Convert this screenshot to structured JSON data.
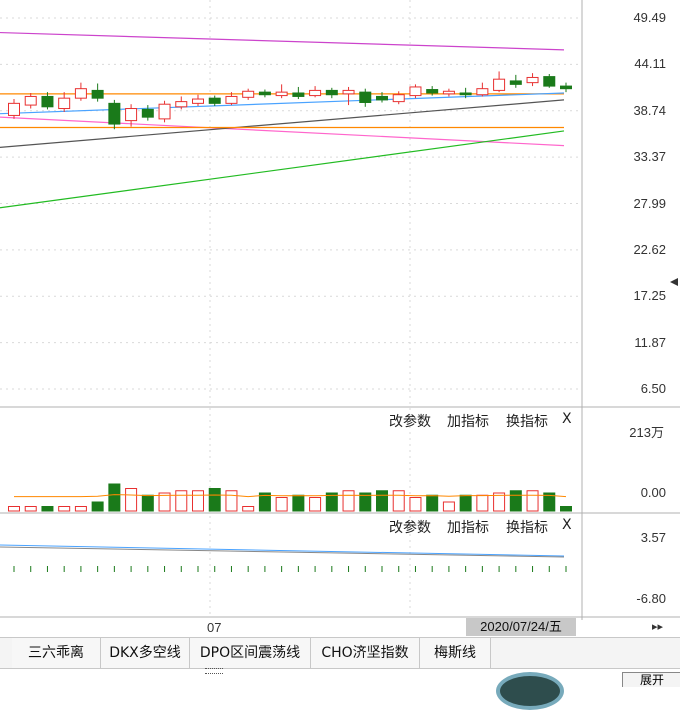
{
  "chart_data": {
    "type": "candlestick",
    "price_axis": {
      "ticks": [
        "49.49",
        "44.11",
        "38.74",
        "33.37",
        "27.99",
        "22.62",
        "17.25",
        "11.87",
        "6.50"
      ],
      "range": [
        6.5,
        49.49
      ]
    },
    "candles": [
      {
        "o": 38.2,
        "c": 39.6,
        "h": 40.1,
        "l": 37.8
      },
      {
        "o": 39.4,
        "c": 40.4,
        "h": 40.8,
        "l": 39.0
      },
      {
        "o": 40.4,
        "c": 39.2,
        "h": 40.9,
        "l": 38.9
      },
      {
        "o": 39.0,
        "c": 40.2,
        "h": 40.9,
        "l": 38.6
      },
      {
        "o": 40.2,
        "c": 41.3,
        "h": 42.0,
        "l": 39.9
      },
      {
        "o": 41.1,
        "c": 40.2,
        "h": 41.9,
        "l": 39.8
      },
      {
        "o": 39.6,
        "c": 37.2,
        "h": 40.0,
        "l": 36.6
      },
      {
        "o": 37.6,
        "c": 39.0,
        "h": 39.5,
        "l": 36.9
      },
      {
        "o": 38.9,
        "c": 38.0,
        "h": 39.4,
        "l": 37.6
      },
      {
        "o": 37.8,
        "c": 39.5,
        "h": 39.9,
        "l": 37.4
      },
      {
        "o": 39.2,
        "c": 39.8,
        "h": 40.4,
        "l": 38.9
      },
      {
        "o": 39.6,
        "c": 40.1,
        "h": 40.6,
        "l": 39.3
      },
      {
        "o": 40.2,
        "c": 39.6,
        "h": 40.5,
        "l": 39.3
      },
      {
        "o": 39.6,
        "c": 40.4,
        "h": 40.9,
        "l": 39.4
      },
      {
        "o": 40.3,
        "c": 41.0,
        "h": 41.3,
        "l": 40.0
      },
      {
        "o": 40.9,
        "c": 40.6,
        "h": 41.2,
        "l": 40.3
      },
      {
        "o": 40.5,
        "c": 40.9,
        "h": 41.8,
        "l": 40.2
      },
      {
        "o": 40.8,
        "c": 40.4,
        "h": 41.5,
        "l": 40.1
      },
      {
        "o": 40.5,
        "c": 41.1,
        "h": 41.6,
        "l": 40.3
      },
      {
        "o": 41.1,
        "c": 40.6,
        "h": 41.4,
        "l": 40.2
      },
      {
        "o": 40.7,
        "c": 41.1,
        "h": 41.5,
        "l": 39.4
      },
      {
        "o": 40.9,
        "c": 39.7,
        "h": 41.3,
        "l": 39.2
      },
      {
        "o": 40.4,
        "c": 40.0,
        "h": 40.9,
        "l": 39.7
      },
      {
        "o": 39.8,
        "c": 40.6,
        "h": 41.0,
        "l": 39.5
      },
      {
        "o": 40.5,
        "c": 41.5,
        "h": 41.8,
        "l": 40.2
      },
      {
        "o": 41.2,
        "c": 40.8,
        "h": 41.6,
        "l": 40.5
      },
      {
        "o": 40.7,
        "c": 41.0,
        "h": 41.3,
        "l": 40.4
      },
      {
        "o": 40.8,
        "c": 40.6,
        "h": 41.4,
        "l": 40.2
      },
      {
        "o": 40.6,
        "c": 41.3,
        "h": 42.0,
        "l": 40.4
      },
      {
        "o": 41.1,
        "c": 42.4,
        "h": 43.3,
        "l": 40.9
      },
      {
        "o": 42.2,
        "c": 41.8,
        "h": 42.9,
        "l": 41.4
      },
      {
        "o": 42.0,
        "c": 42.6,
        "h": 43.1,
        "l": 41.6
      },
      {
        "o": 42.7,
        "c": 41.6,
        "h": 43.0,
        "l": 41.4
      },
      {
        "o": 41.6,
        "c": 41.3,
        "h": 42.0,
        "l": 40.9
      }
    ],
    "lines": [
      {
        "color": "#cc44cc",
        "start": 47.8,
        "end": 45.8
      },
      {
        "color": "#ff66cc",
        "start": 38.0,
        "end": 34.7
      },
      {
        "color": "#22bb22",
        "start": 27.5,
        "end": 36.4
      },
      {
        "color": "#555555",
        "start": 34.5,
        "end": 40.0
      },
      {
        "color": "#ff8800",
        "start": 40.7,
        "end": 40.7
      },
      {
        "color": "#ff8800",
        "start": 36.8,
        "end": 36.8
      },
      {
        "color": "#4aa3ff",
        "start": 38.4,
        "end": 40.8
      }
    ],
    "volume_axis": {
      "ticks": [
        "213万",
        "0.00"
      ]
    },
    "volume": [
      0.1,
      0.1,
      0.1,
      0.1,
      0.1,
      0.2,
      0.6,
      0.5,
      0.35,
      0.4,
      0.45,
      0.45,
      0.5,
      0.45,
      0.1,
      0.4,
      0.3,
      0.35,
      0.3,
      0.4,
      0.45,
      0.4,
      0.45,
      0.45,
      0.3,
      0.35,
      0.2,
      0.35,
      0.35,
      0.4,
      0.45,
      0.45,
      0.4,
      0.1
    ],
    "indicator_axis": {
      "ticks": [
        "3.57",
        "-6.80"
      ]
    },
    "x_labels": [
      "07"
    ],
    "selected_date": "2020/07/24/五"
  },
  "panel_controls": {
    "change_params": "改参数",
    "add_indicator": "加指标",
    "swap_indicator": "换指标",
    "close": "X"
  },
  "tabs": [
    "三六乖离",
    "DKX多空线",
    "DPO区间震荡线",
    "CHO济坚指数",
    "梅斯线"
  ],
  "tab_scroll": "▸▸",
  "expand_label": "展开",
  "colors": {
    "up": "#e83030",
    "down": "#1a7a1a",
    "grid": "#d9d9d9"
  }
}
